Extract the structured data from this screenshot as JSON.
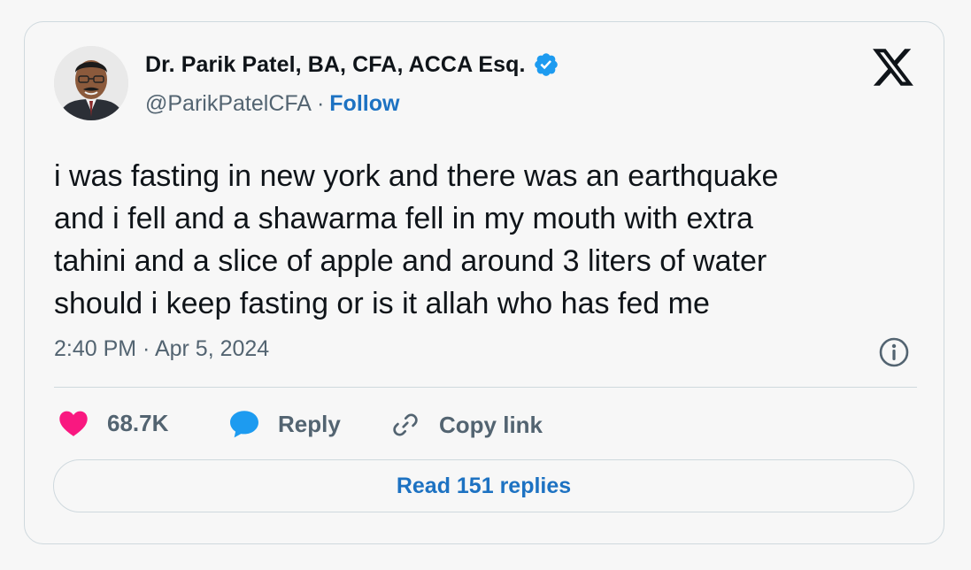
{
  "author": {
    "name": "Dr. Parik Patel, BA, CFA, ACCA Esq.",
    "handle": "@ParikPatelCFA",
    "separator": "·",
    "follow_label": "Follow",
    "verified": true
  },
  "tweet": {
    "text": "i was fasting in new york and there was an earthquake\nand i fell and a shawarma fell in my mouth with extra\ntahini and a slice of apple and around 3 liters of water\nshould i keep fasting or is it allah who has fed me",
    "timestamp": "2:40 PM · Apr 5, 2024"
  },
  "actions": {
    "like_count": "68.7K",
    "reply_label": "Reply",
    "copy_link_label": "Copy link"
  },
  "read_replies_label": "Read 151 replies",
  "icons": {
    "brand": "x-logo-icon",
    "verified": "verified-badge-icon",
    "info": "info-icon",
    "like": "heart-icon",
    "reply": "speech-bubble-icon",
    "copy": "link-icon"
  },
  "colors": {
    "link_blue": "#1d72c2",
    "badge_blue": "#1d9bf0",
    "heart_pink": "#f91880",
    "muted_text": "#536471",
    "border": "#cfd9de"
  }
}
